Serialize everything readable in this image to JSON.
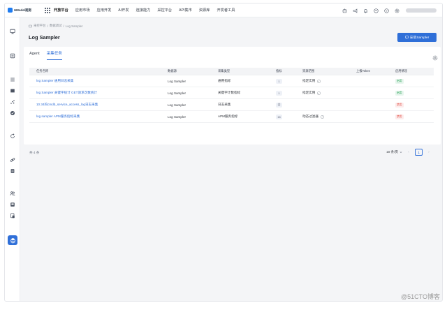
{
  "app": {
    "logo_text": "UModel观测",
    "accent_color": "#2f6fd8"
  },
  "topnav": {
    "items": [
      "开放平台",
      "应用市场",
      "应用开发",
      "AI开发",
      "连接能力",
      "采控平台",
      "API集市",
      "资源库",
      "开发者工具"
    ],
    "active_index": 0,
    "right_icons": [
      "bot-icon",
      "megaphone-icon",
      "bell-icon",
      "message-icon",
      "help-icon",
      "settings-icon"
    ]
  },
  "sidebar": {
    "icons": [
      "monitor-icon",
      "chart-icon",
      "list-icon",
      "document-icon",
      "scatter-icon",
      "shield-icon",
      "refresh-icon",
      "link-icon",
      "database-icon",
      "users-icon",
      "inbox-icon",
      "file-icon",
      "layers-icon"
    ],
    "active_icon": "layers-icon"
  },
  "breadcrumb": {
    "items": [
      "采控平台",
      "数据调试",
      "Log Sampler"
    ],
    "separator": "/"
  },
  "page": {
    "title": "Log Sampler",
    "install_button": "安装Sampler"
  },
  "tabs": {
    "items": [
      "Agent",
      "采集任务"
    ],
    "active_index": 1
  },
  "table": {
    "columns": [
      "任务名称",
      "数据源",
      "采集类型",
      "指标",
      "资源范围",
      "上报Token",
      "启用情况"
    ],
    "rows": [
      {
        "name": "log Sampler 通用日志采集",
        "source": "Log Sampler",
        "type": "通用指标",
        "metric": "1",
        "scope": "指定实例",
        "token": "",
        "status": "启用",
        "enabled": true
      },
      {
        "name": "log Sampler 关键字统计 GET请求次数统计",
        "source": "Log Sampler",
        "type": "关键字计数指标",
        "metric": "1",
        "scope": "指定实例",
        "token": "",
        "status": "启用",
        "enabled": true
      },
      {
        "name": "10.34的cmdb_service_access_log日志采集",
        "source": "Log Sampler",
        "type": "日志采集",
        "metric": "全",
        "scope": "",
        "token": "",
        "status": "禁用",
        "enabled": false
      },
      {
        "name": "log sampler APM服务指标采集",
        "source": "Log Sampler",
        "type": "APM服务指标",
        "metric": "16",
        "scope": "动态过滤器",
        "token": "",
        "status": "禁用",
        "enabled": false
      }
    ]
  },
  "pagination": {
    "total_text": "共 4 条",
    "page_size": "10 条/页",
    "current_page": "1"
  },
  "watermark": "@51CTO博客"
}
